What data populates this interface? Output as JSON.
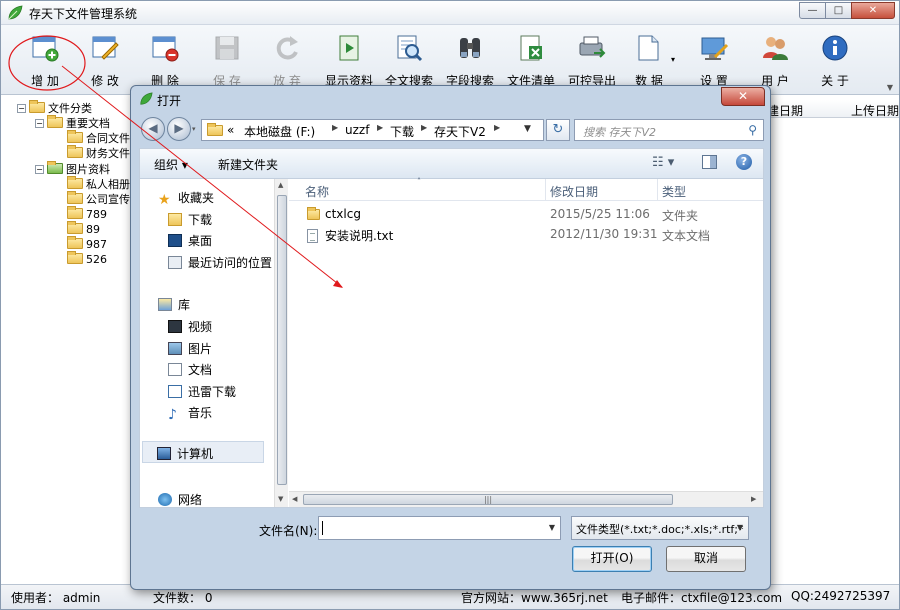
{
  "app": {
    "title": "存天下文件管理系统",
    "window_buttons": {
      "minimize": "—",
      "maximize": "□",
      "close": "✕"
    }
  },
  "toolbar": {
    "buttons": [
      {
        "id": "add",
        "label": "增 加",
        "icon": "add-icon",
        "enabled": true
      },
      {
        "id": "edit",
        "label": "修 改",
        "icon": "edit-icon",
        "enabled": true
      },
      {
        "id": "delete",
        "label": "删 除",
        "icon": "delete-icon",
        "enabled": true
      },
      {
        "id": "save",
        "label": "保 存",
        "icon": "save-icon",
        "enabled": false
      },
      {
        "id": "discard",
        "label": "放 弃",
        "icon": "undo-icon",
        "enabled": false
      },
      {
        "id": "show",
        "label": "显示资料",
        "icon": "show-data-icon",
        "enabled": true
      },
      {
        "id": "fulltext",
        "label": "全文搜索",
        "icon": "search-document-icon",
        "enabled": true
      },
      {
        "id": "fieldsearch",
        "label": "字段搜索",
        "icon": "binoculars-icon",
        "enabled": true
      },
      {
        "id": "filelist",
        "label": "文件清单",
        "icon": "excel-icon",
        "enabled": true
      },
      {
        "id": "export",
        "label": "可控导出",
        "icon": "export-icon",
        "enabled": true
      },
      {
        "id": "data",
        "label": "数 据",
        "icon": "data-icon",
        "enabled": true
      },
      {
        "id": "settings",
        "label": "设 置",
        "icon": "settings-icon",
        "enabled": true
      },
      {
        "id": "users",
        "label": "用 户",
        "icon": "users-icon",
        "enabled": true
      },
      {
        "id": "about",
        "label": "关 于",
        "icon": "info-icon",
        "enabled": true
      }
    ]
  },
  "tree": {
    "nodes": [
      {
        "label": "文件分类",
        "level": 0,
        "expander": "−"
      },
      {
        "label": "重要文档",
        "level": 1,
        "expander": "−"
      },
      {
        "label": "合同文件",
        "level": 2
      },
      {
        "label": "财务文件",
        "level": 2
      },
      {
        "label": "图片资料",
        "level": 1,
        "expander": "−",
        "green": true
      },
      {
        "label": "私人相册",
        "level": 2
      },
      {
        "label": "公司宣传",
        "level": 2
      },
      {
        "label": "789",
        "level": 2
      },
      {
        "label": "89",
        "level": 2
      },
      {
        "label": "987",
        "level": 2
      },
      {
        "label": "526",
        "level": 2
      }
    ]
  },
  "grid": {
    "headers": [
      "建日期",
      "上传日期"
    ]
  },
  "status": {
    "user": "使用者：  admin",
    "count": "文件数：  0",
    "website": "官方网站：www.365rj.net",
    "email": "电子邮件：ctxfile@123.com",
    "qq": "QQ:2492725397"
  },
  "dialog": {
    "title": "打开",
    "close": "✕",
    "back": "◀",
    "forward": "▶",
    "path": [
      "«",
      "本地磁盘 (F:)",
      "uzzf",
      "下载",
      "存天下V2"
    ],
    "refresh": "↻",
    "search_placeholder": "搜索 存天下V2",
    "search_icon": "magnifier-icon",
    "commands": {
      "organize": "组织 ▾",
      "new_folder": "新建文件夹",
      "view": "☷ ▾",
      "help": "?"
    },
    "nav": {
      "favorites": "收藏夹",
      "fav_items": [
        "下载",
        "桌面",
        "最近访问的位置"
      ],
      "libraries": "库",
      "lib_items": [
        "视频",
        "图片",
        "文档",
        "迅雷下载",
        "音乐"
      ],
      "computer": "计算机",
      "network": "网络"
    },
    "columns": [
      "名称",
      "修改日期",
      "类型"
    ],
    "files": [
      {
        "name": "ctxlcg",
        "date": "2015/5/25 11:06",
        "type": "文件夹",
        "kind": "folder"
      },
      {
        "name": "安装说明.txt",
        "date": "2012/11/30 19:31",
        "type": "文本文档",
        "kind": "text"
      }
    ],
    "filename_label": "文件名(N):",
    "filename_value": "",
    "filter": "文件类型(*.txt;*.doc;*.xls;*.rtf;*",
    "open_button": "打开(O)",
    "cancel_button": "取消"
  },
  "colors": {
    "accent": "#3a6ea5",
    "annotation": "#e0191c"
  }
}
